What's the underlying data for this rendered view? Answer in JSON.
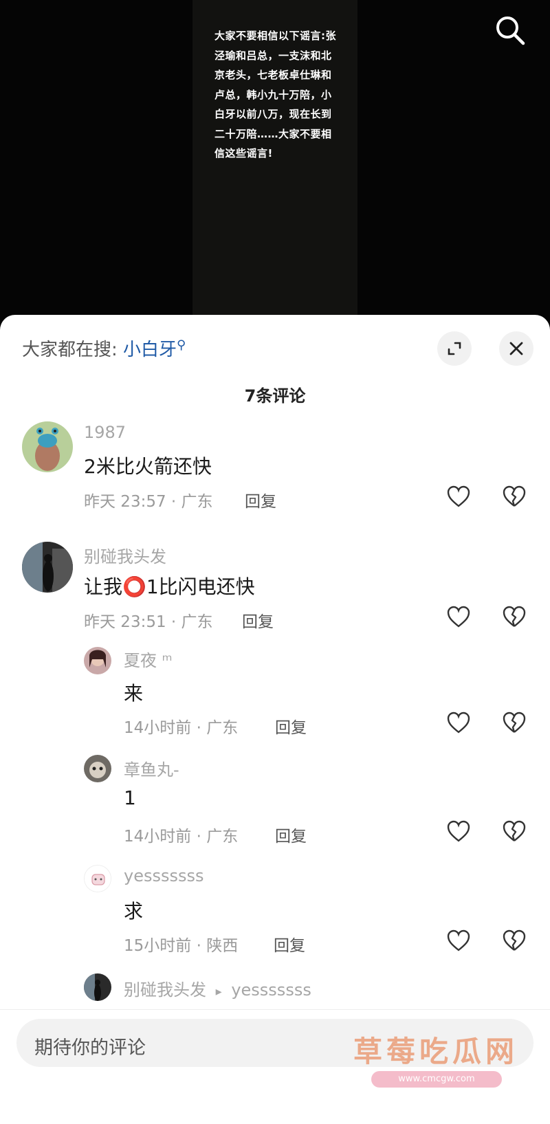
{
  "video": {
    "caption": "大家不要相信以下谣言:张泾瑜和吕总，一支沫和北京老头，七老板卓仕琳和卢总，韩小九十万陪，小白牙以前八万，现在长到二十万陪……大家不要相信这些谣言!"
  },
  "sheet": {
    "hot_search_prefix": "大家都在搜: ",
    "hot_search_keyword": "小白牙",
    "comment_count": "7条评论"
  },
  "comments": [
    {
      "user": "1987",
      "text": "2米比火箭还快",
      "meta": "昨天 23:57 · 广东",
      "reply": "回复"
    },
    {
      "user": "别碰我头发",
      "text": "让我⭕1比闪电还快",
      "meta": "昨天 23:51 · 广东",
      "reply": "回复"
    },
    {
      "user": "夏夜",
      "user_suffix": "ᵐ",
      "text": "来",
      "meta": "14小时前 · 广东",
      "reply": "回复"
    },
    {
      "user": "章鱼丸-",
      "text": "1",
      "meta": "14小时前 · 广东",
      "reply": "回复"
    },
    {
      "user": "yesssssss",
      "text": "求",
      "meta": "15小时前 · 陕西",
      "reply": "回复"
    },
    {
      "user": "别碰我头发",
      "reply_arrow": "▸",
      "reply_to": "yesssssss"
    }
  ],
  "input": {
    "placeholder": "期待你的评论"
  },
  "watermark": {
    "text": "草莓吃瓜网",
    "url": "www.cmcgw.com"
  },
  "icons": {
    "search": "search-icon",
    "expand": "expand-icon",
    "close": "close-icon",
    "like": "heart-icon",
    "dislike": "broken-heart-icon"
  }
}
